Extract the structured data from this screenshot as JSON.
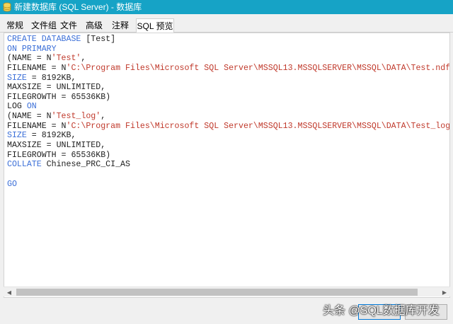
{
  "window": {
    "title": "新建数据库 (SQL Server) - 数据库",
    "icon": "database-icon",
    "accent_color": "#16a3c6"
  },
  "tabs": [
    {
      "label": "常规",
      "active": false
    },
    {
      "label": "文件组",
      "active": false
    },
    {
      "label": "文件",
      "active": false
    },
    {
      "label": "高级",
      "active": false
    },
    {
      "label": "注释",
      "active": false
    },
    {
      "label": "SQL 预览",
      "active": true
    }
  ],
  "editor": {
    "keyword_color": "#3b6fd8",
    "string_color": "#c0392b",
    "lines": [
      [
        {
          "t": "CREATE DATABASE",
          "c": "kw"
        },
        {
          "t": " [Test]",
          "c": ""
        }
      ],
      [
        {
          "t": "ON PRIMARY",
          "c": "kw"
        }
      ],
      [
        {
          "t": "(NAME = N",
          "c": ""
        },
        {
          "t": "'Test'",
          "c": "str"
        },
        {
          "t": ",",
          "c": ""
        }
      ],
      [
        {
          "t": "FILENAME = N",
          "c": ""
        },
        {
          "t": "'C:\\Program Files\\Microsoft SQL Server\\MSSQL13.MSSQLSERVER\\MSSQL\\DATA\\Test.ndf'",
          "c": "str"
        }
      ],
      [
        {
          "t": "SIZE",
          "c": "kw"
        },
        {
          "t": " = 8192KB,",
          "c": ""
        }
      ],
      [
        {
          "t": "MAXSIZE = UNLIMITED,",
          "c": ""
        }
      ],
      [
        {
          "t": "FILEGROWTH = 65536KB)",
          "c": ""
        }
      ],
      [
        {
          "t": "LOG ",
          "c": ""
        },
        {
          "t": "ON",
          "c": "kw"
        }
      ],
      [
        {
          "t": "(NAME = N",
          "c": ""
        },
        {
          "t": "'Test_log'",
          "c": "str"
        },
        {
          "t": ",",
          "c": ""
        }
      ],
      [
        {
          "t": "FILENAME = N",
          "c": ""
        },
        {
          "t": "'C:\\Program Files\\Microsoft SQL Server\\MSSQL13.MSSQLSERVER\\MSSQL\\DATA\\Test_log.",
          "c": "str"
        }
      ],
      [
        {
          "t": "SIZE",
          "c": "kw"
        },
        {
          "t": " = 8192KB,",
          "c": ""
        }
      ],
      [
        {
          "t": "MAXSIZE = UNLIMITED,",
          "c": ""
        }
      ],
      [
        {
          "t": "FILEGROWTH = 65536KB)",
          "c": ""
        }
      ],
      [
        {
          "t": "COLLATE",
          "c": "kw"
        },
        {
          "t": " Chinese_PRC_CI_AS",
          "c": ""
        }
      ],
      [],
      [
        {
          "t": "GO",
          "c": "kw"
        }
      ]
    ]
  },
  "footer": {
    "watermark": "头条 @SQL数据库开发"
  }
}
